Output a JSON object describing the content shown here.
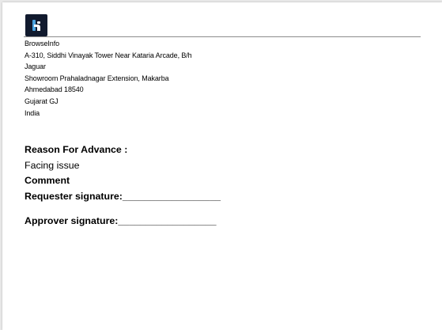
{
  "company": {
    "name": "BrowseInfo",
    "address_lines": [
      "A-310, Siddhi Vinayak Tower Near Kataria Arcade, B/h",
      "Jaguar",
      "Showroom Prahaladnagar Extension, Makarba",
      "Ahmedabad 18540",
      "Gujarat GJ",
      "India"
    ],
    "logo_colors": {
      "background": "#111a2e",
      "mark": "#4aa3df"
    }
  },
  "form": {
    "reason_label": "Reason For Advance :",
    "reason_value": "Facing issue",
    "comment_label": "Comment",
    "requester_signature": "Requester signature:__________________",
    "approver_signature": "Approver signature:__________________"
  }
}
